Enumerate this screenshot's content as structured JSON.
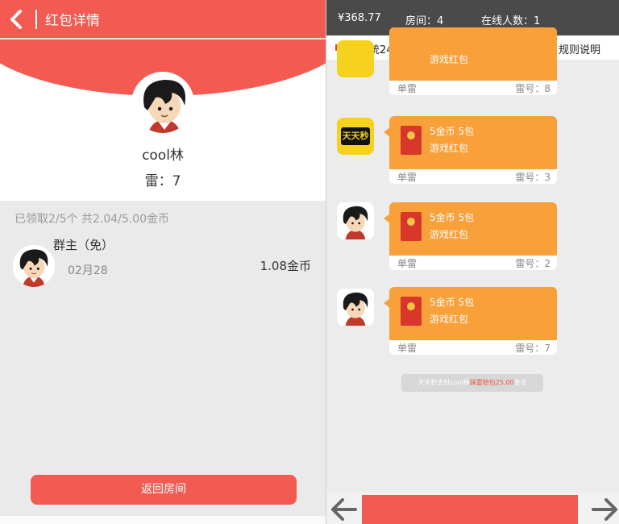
{
  "left_panel": {
    "header_title": "红包详情",
    "user_name": "cool林",
    "mine_number": "雷：7",
    "summary": "已领取2/5个   共2.04/5.00金币",
    "records": [
      {
        "name": "群主（免）",
        "date": "02月28",
        "amount": "1.08金币"
      }
    ],
    "return_button": "返回房间"
  },
  "right_panel": {
    "balance": "¥368.77",
    "room": "房间：4",
    "online": "在线人数：1",
    "notice": "系统24小时在线自动充值，提现。",
    "rules_link": "规则说明",
    "messages": [
      {
        "avatar": "game-logo",
        "title": "",
        "subtitle": "游戏红包",
        "footer_left": "单雷",
        "footer_right": "雷号：8"
      },
      {
        "avatar": "tiantian-logo",
        "avatar_text": "天天秒",
        "title": "5金币 5包",
        "subtitle": "游戏红包",
        "footer_left": "单雷",
        "footer_right": "雷号：3"
      },
      {
        "avatar": "cartoon-avatar",
        "title": "5金币 5包",
        "subtitle": "游戏红包",
        "footer_left": "单雷",
        "footer_right": "雷号：2"
      },
      {
        "avatar": "cartoon-avatar",
        "title": "5金币 5包",
        "subtitle": "游戏红包",
        "footer_left": "单雷",
        "footer_right": "雷号：7"
      }
    ],
    "system_message": {
      "prefix": "天天秒支付cool林",
      "highlight": "踩雷赔包25.00",
      "suffix": "金币"
    }
  },
  "colors": {
    "primary_red": "#f25a52",
    "bubble_orange": "#f8a03a",
    "top_bar": "#4a4a4a",
    "envelope_red": "#d9372a",
    "logo_yellow": "#f6d21e"
  }
}
